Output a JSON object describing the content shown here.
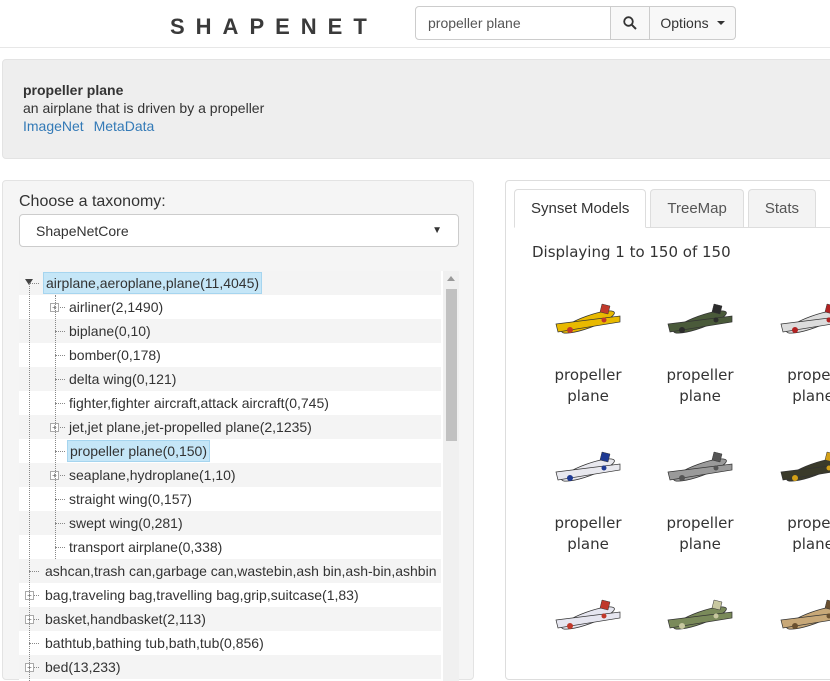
{
  "header": {
    "logo_text": "SHAPENET",
    "search_value": "propeller plane",
    "options_label": "Options"
  },
  "synset": {
    "title": "propeller plane",
    "description": "an airplane that is driven by a propeller",
    "links": [
      "ImageNet",
      "MetaData"
    ]
  },
  "taxonomy": {
    "label": "Choose a taxonomy:",
    "selected": "ShapeNetCore"
  },
  "tree": {
    "rows": [
      {
        "label": "airplane,aeroplane,plane(11,4045)",
        "level": 0,
        "expanded": true,
        "selected": true
      },
      {
        "label": "airliner(2,1490)",
        "level": 1,
        "has_children": true
      },
      {
        "label": "biplane(0,10)",
        "level": 1
      },
      {
        "label": "bomber(0,178)",
        "level": 1
      },
      {
        "label": "delta wing(0,121)",
        "level": 1
      },
      {
        "label": "fighter,fighter aircraft,attack aircraft(0,745)",
        "level": 1
      },
      {
        "label": "jet,jet plane,jet-propelled plane(2,1235)",
        "level": 1,
        "has_children": true
      },
      {
        "label": "propeller plane(0,150)",
        "level": 1,
        "selected": true
      },
      {
        "label": "seaplane,hydroplane(1,10)",
        "level": 1,
        "has_children": true
      },
      {
        "label": "straight wing(0,157)",
        "level": 1
      },
      {
        "label": "swept wing(0,281)",
        "level": 1
      },
      {
        "label": "transport airplane(0,338)",
        "level": 1
      },
      {
        "label": "ashcan,trash can,garbage can,wastebin,ash bin,ash-bin,ashbin",
        "level": 0
      },
      {
        "label": "bag,traveling bag,travelling bag,grip,suitcase(1,83)",
        "level": 0,
        "has_children": true
      },
      {
        "label": "basket,handbasket(2,113)",
        "level": 0,
        "has_children": true
      },
      {
        "label": "bathtub,bathing tub,bath,tub(0,856)",
        "level": 0
      },
      {
        "label": "bed(13,233)",
        "level": 0,
        "has_children": true
      }
    ]
  },
  "tabs": [
    "Synset Models",
    "TreeMap",
    "Stats"
  ],
  "results": {
    "displaying_text": "Displaying 1 to 150 of 150",
    "model_label": "propeller plane",
    "models": [
      {
        "name_line1": "propeller",
        "name_line2": "plane",
        "color": "#e8b900",
        "accent": "#c0392b"
      },
      {
        "name_line1": "propeller",
        "name_line2": "plane",
        "color": "#4a5a3a",
        "accent": "#2c2c2c"
      },
      {
        "name_line1": "propell",
        "name_line2": "plane",
        "color": "#dcdcdc",
        "accent": "#b22222"
      },
      {
        "name_line1": "propeller",
        "name_line2": "plane",
        "color": "#e8e8ee",
        "accent": "#1f3a93"
      },
      {
        "name_line1": "propeller",
        "name_line2": "plane",
        "color": "#9a9a9a",
        "accent": "#555"
      },
      {
        "name_line1": "propell",
        "name_line2": "plane",
        "color": "#3a3a2a",
        "accent": "#d4a017"
      },
      {
        "name_line1": "",
        "name_line2": "",
        "color": "#e6e6f0",
        "accent": "#c0392b"
      },
      {
        "name_line1": "",
        "name_line2": "",
        "color": "#7a8a5a",
        "accent": "#c8c8a0"
      },
      {
        "name_line1": "",
        "name_line2": "",
        "color": "#c8a878",
        "accent": "#6a5030"
      }
    ]
  }
}
